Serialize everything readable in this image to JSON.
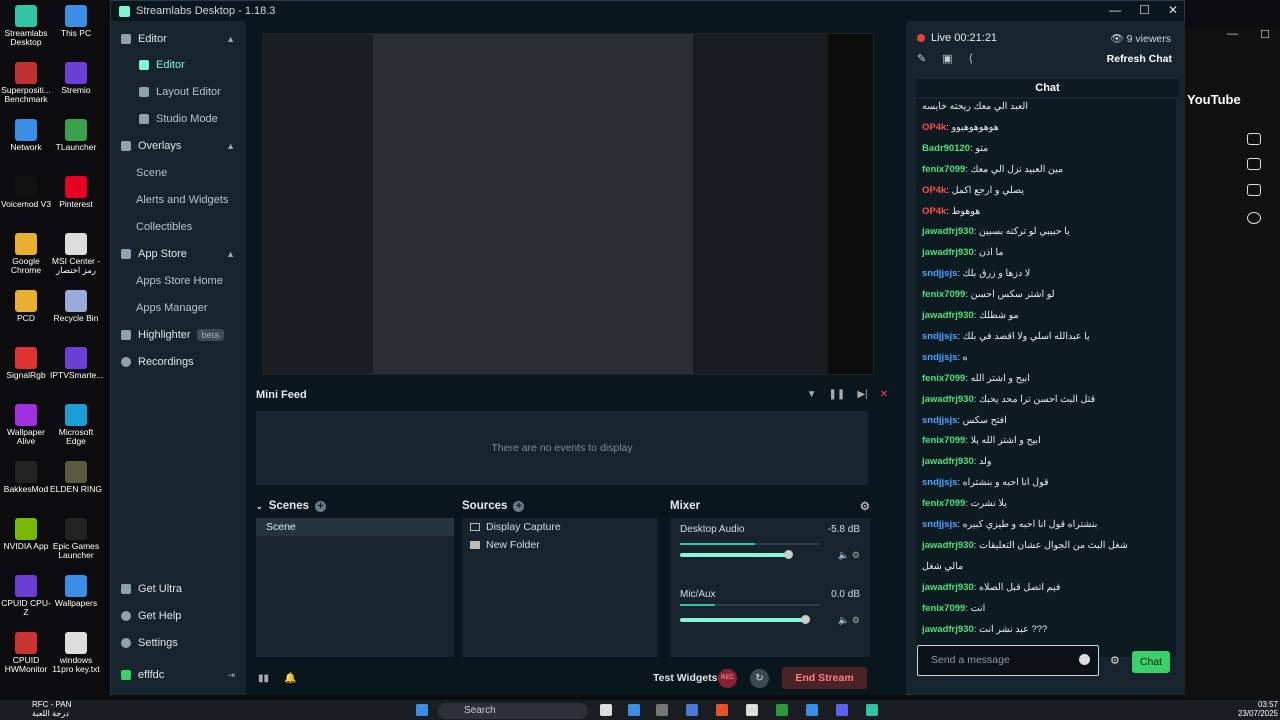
{
  "desktop": {
    "icons": [
      {
        "label": "Streamlabs Desktop",
        "color": "#31c3a2"
      },
      {
        "label": "This PC",
        "color": "#3a8ee6"
      },
      {
        "label": "Superpositi... Benchmark",
        "color": "#c03030"
      },
      {
        "label": "Stremio",
        "color": "#6b3fd6"
      },
      {
        "label": "Network",
        "color": "#3a8ee6"
      },
      {
        "label": "TLauncher",
        "color": "#3aa04a"
      },
      {
        "label": "Voicemod V3",
        "color": "#111"
      },
      {
        "label": "Pinterest",
        "color": "#e60023"
      },
      {
        "label": "Google Chrome",
        "color": "#e8b030"
      },
      {
        "label": "MSI Center - رمز اختصار",
        "color": "#ddd"
      },
      {
        "label": "PCD",
        "color": "#e8b030"
      },
      {
        "label": "Recycle Bin",
        "color": "#9ad"
      },
      {
        "label": "SignalRgb",
        "color": "#d33"
      },
      {
        "label": "IPTVSmarte...",
        "color": "#6b3fd6"
      },
      {
        "label": "Wallpaper Alive",
        "color": "#a030e0"
      },
      {
        "label": "Microsoft Edge",
        "color": "#1a9ed8"
      },
      {
        "label": "BakkesMod",
        "color": "#222"
      },
      {
        "label": "ELDEN RING",
        "color": "#5a5a40"
      },
      {
        "label": "NVIDIA App",
        "color": "#76b900"
      },
      {
        "label": "Epic Games Launcher",
        "color": "#222"
      },
      {
        "label": "CPUID CPU-Z",
        "color": "#6b3fd6"
      },
      {
        "label": "Wallpapers",
        "color": "#3a8ee6"
      },
      {
        "label": "CPUID HWMonitor",
        "color": "#c33"
      },
      {
        "label": "windows 11pro key.txt",
        "color": "#ddd"
      }
    ]
  },
  "window": {
    "title": "Streamlabs Desktop - 1.18.3",
    "minimize": "—",
    "maximize": "☐",
    "close": "✕"
  },
  "sidebar": {
    "editor_group": "Editor",
    "items_editor": [
      "Editor",
      "Layout Editor",
      "Studio Mode"
    ],
    "overlays_group": "Overlays",
    "items_overlays": [
      "Scene",
      "Alerts and Widgets",
      "Collectibles"
    ],
    "appstore_group": "App Store",
    "items_appstore": [
      "Apps Store Home",
      "Apps Manager"
    ],
    "highlighter": "Highlighter",
    "highlighter_badge": "beta",
    "recordings": "Recordings",
    "get_ultra": "Get Ultra",
    "get_help": "Get Help",
    "settings": "Settings",
    "user": "eflfdc"
  },
  "minifeed": {
    "title": "Mini Feed",
    "empty": "There are no events to display"
  },
  "scenes": {
    "title": "Scenes",
    "items": [
      "Scene"
    ]
  },
  "sources": {
    "title": "Sources",
    "items": [
      "Display Capture",
      "New Folder"
    ]
  },
  "mixer": {
    "title": "Mixer",
    "channels": [
      {
        "name": "Desktop Audio",
        "db": "-5.8 dB",
        "level": 0.78
      },
      {
        "name": "Mic/Aux",
        "db": "0.0 dB",
        "level": 0.9
      }
    ]
  },
  "footer": {
    "test_widgets": "Test Widgets",
    "rec": "REC",
    "end_stream": "End Stream"
  },
  "chat": {
    "live": "Live 00:21:21",
    "viewers": "9 viewers",
    "refresh": "Refresh Chat",
    "title": "Chat",
    "placeholder": "Send a message",
    "send": "Chat",
    "messages": [
      {
        "user": "",
        "text": "العبد الي معك ريحته خايسه",
        "color": "#ff4d4d"
      },
      {
        "user": "OP4k",
        "text": "هوهوهوهيوو",
        "color": "#ff4d4d"
      },
      {
        "user": "Badr90120",
        "text": "متو",
        "color": "#4ce07a"
      },
      {
        "user": "fenix7099",
        "text": "مين العبيد نزل الي معك",
        "color": "#4ce07a"
      },
      {
        "user": "OP4k",
        "text": "يصلي و ارجع اكمل",
        "color": "#ff4d4d"
      },
      {
        "user": "OP4k",
        "text": "هوهوط",
        "color": "#ff4d4d"
      },
      {
        "user": "jawadfrj930",
        "text": "يا حبيبي لو تركته بسبين",
        "color": "#4ce07a"
      },
      {
        "user": "jawadfrj930",
        "text": "ما اذن",
        "color": "#4ce07a"
      },
      {
        "user": "sndjjsjs",
        "text": "لا دزها و زرق بلك",
        "color": "#4aa4ff"
      },
      {
        "user": "fenix7099",
        "text": "لو اشتر سكس احسن",
        "color": "#4ce07a"
      },
      {
        "user": "jawadfrj930",
        "text": "مو شطلك",
        "color": "#4ce07a"
      },
      {
        "user": "sndjjsjs",
        "text": "يا عبدالله اسلي ولا اقصد في بلك",
        "color": "#4aa4ff"
      },
      {
        "user": "sndjjsjs",
        "text": "ه",
        "color": "#4aa4ff"
      },
      {
        "user": "fenix7099",
        "text": "ابيح و اشتر الله",
        "color": "#4ce07a"
      },
      {
        "user": "jawadfrj930",
        "text": "قتل البث احسن ترا محد يحبك",
        "color": "#4ce07a"
      },
      {
        "user": "sndjjsjs",
        "text": "افتح سكس",
        "color": "#4aa4ff"
      },
      {
        "user": "fenix7099",
        "text": "ابيح و اشتر الله يلا",
        "color": "#4ce07a"
      },
      {
        "user": "jawadfrj930",
        "text": "ولد",
        "color": "#4ce07a"
      },
      {
        "user": "sndjjsjs",
        "text": "قول انا احبه و بنشتراه",
        "color": "#4aa4ff"
      },
      {
        "user": "fenix7099",
        "text": "يلا نشرت",
        "color": "#4ce07a"
      },
      {
        "user": "sndjjsjs",
        "text": "بنشتراه قول انا احبه و طيزي كبيره",
        "color": "#4aa4ff"
      },
      {
        "user": "jawadfrj930",
        "text": "شغل البث من الجوال عشان التعليقات",
        "color": "#4ce07a"
      },
      {
        "user": "",
        "text": "مالي شغل",
        "color": "#4ce07a"
      },
      {
        "user": "jawadfrj930",
        "text": "فيم اتصل قبل الصلاه",
        "color": "#4ce07a"
      },
      {
        "user": "fenix7099",
        "text": "انت",
        "color": "#4ce07a"
      },
      {
        "user": "jawadfrj930",
        "text": "عبد نشر انت ???",
        "color": "#4ce07a"
      }
    ]
  },
  "browser": {
    "yt": "YouTube",
    "min": "—",
    "max": "☐"
  },
  "taskbar": {
    "search": "Search",
    "time": "03:57",
    "date": "23/07/2025",
    "left1": "RFC - PAN",
    "left2": "درجة اللعبة"
  }
}
